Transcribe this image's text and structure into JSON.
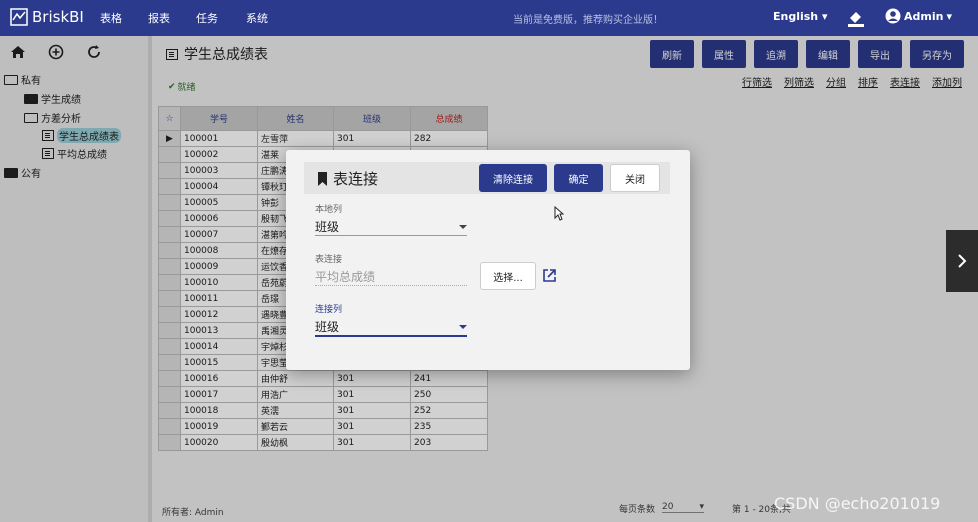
{
  "app": {
    "logo": "BriskBI",
    "nav": [
      "表格",
      "报表",
      "任务",
      "系统"
    ],
    "notice": "当前是免费版，推荐购买企业版！",
    "language": "English",
    "user": "Admin"
  },
  "sidebar": {
    "tree": [
      {
        "label": "私有",
        "level": 0,
        "icon": "folder-open-icon"
      },
      {
        "label": "学生成绩",
        "level": 1,
        "icon": "folder-icon"
      },
      {
        "label": "方差分析",
        "level": 1,
        "icon": "folder-open-icon"
      },
      {
        "label": "学生总成绩表",
        "level": 2,
        "icon": "table-icon",
        "selected": true
      },
      {
        "label": "平均总成绩",
        "level": 2,
        "icon": "table-icon"
      },
      {
        "label": "公有",
        "level": 0,
        "icon": "folder-icon"
      }
    ]
  },
  "main": {
    "title": "学生总成绩表",
    "status": "就绪",
    "buttons": [
      "刷新",
      "属性",
      "追溯",
      "编辑",
      "导出",
      "另存为"
    ],
    "links": [
      "行筛选",
      "列筛选",
      "分组",
      "排序",
      "表连接",
      "添加列"
    ]
  },
  "table": {
    "columns": [
      "学号",
      "姓名",
      "班级",
      "总成绩"
    ],
    "rows": [
      [
        "100001",
        "左雪萍",
        "301",
        "282"
      ],
      [
        "100002",
        "湛莱",
        "",
        ""
      ],
      [
        "100003",
        "庄鹏涛",
        "",
        ""
      ],
      [
        "100004",
        "镡秋玎",
        "",
        ""
      ],
      [
        "100005",
        "钟彭",
        "",
        ""
      ],
      [
        "100006",
        "殷韧飞",
        "",
        ""
      ],
      [
        "100007",
        "湛第吟",
        "",
        ""
      ],
      [
        "100008",
        "在燎存",
        "",
        ""
      ],
      [
        "100009",
        "运饮香",
        "",
        ""
      ],
      [
        "100010",
        "岳苑蔚",
        "",
        ""
      ],
      [
        "100011",
        "岳璟",
        "",
        ""
      ],
      [
        "100012",
        "遇晓豊",
        "",
        ""
      ],
      [
        "100013",
        "禹湘灵",
        "",
        ""
      ],
      [
        "100014",
        "宇焯杉",
        "",
        ""
      ],
      [
        "100015",
        "宇思莹",
        "",
        ""
      ],
      [
        "100016",
        "由仲舒",
        "301",
        "241"
      ],
      [
        "100017",
        "用浩广",
        "301",
        "250"
      ],
      [
        "100018",
        "英濡",
        "301",
        "252"
      ],
      [
        "100019",
        "鄞若云",
        "301",
        "235"
      ],
      [
        "100020",
        "殷幼枫",
        "301",
        "203"
      ]
    ]
  },
  "footer": {
    "owner": "所有者: Admin",
    "page_size_label": "每页条数",
    "page_size": "20",
    "range": "第 1 - 20条,共"
  },
  "dialog": {
    "title": "表连接",
    "clear_label": "清除连接",
    "ok_label": "确定",
    "close_label": "关闭",
    "local_label": "本地列",
    "local_value": "班级",
    "join_table_label": "表连接",
    "join_table_value": "平均总成绩",
    "select_label": "选择...",
    "join_col_label": "连接列",
    "join_col_value": "班级"
  },
  "watermark": "CSDN @echo201019"
}
